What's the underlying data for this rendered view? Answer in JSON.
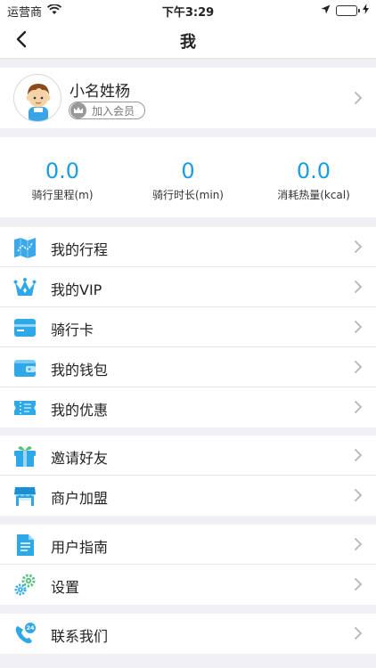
{
  "status_bar": {
    "carrier": "运营商",
    "time": "下午3:29"
  },
  "nav": {
    "title": "我"
  },
  "profile": {
    "name": "小名姓杨",
    "member_badge": "加入会员"
  },
  "stats": [
    {
      "value": "0.0",
      "label": "骑行里程(m)"
    },
    {
      "value": "0",
      "label": "骑行时长(min)"
    },
    {
      "value": "0.0",
      "label": "消耗热量(kcal)"
    }
  ],
  "groups": [
    [
      {
        "label": "我的行程",
        "icon": "map-icon"
      },
      {
        "label": "我的VIP",
        "icon": "crown-icon"
      },
      {
        "label": "骑行卡",
        "icon": "card-icon"
      },
      {
        "label": "我的钱包",
        "icon": "wallet-icon"
      },
      {
        "label": "我的优惠",
        "icon": "coupon-icon"
      }
    ],
    [
      {
        "label": "邀请好友",
        "icon": "gift-icon"
      },
      {
        "label": "商户加盟",
        "icon": "shop-icon"
      }
    ],
    [
      {
        "label": "用户指南",
        "icon": "document-icon"
      },
      {
        "label": "设置",
        "icon": "gear-icon"
      }
    ],
    [
      {
        "label": "联系我们",
        "icon": "phone-24-icon"
      }
    ]
  ],
  "colors": {
    "accent": "#1a9ce3",
    "icon_blue": "#2fa8e8",
    "icon_green": "#57c27d"
  }
}
